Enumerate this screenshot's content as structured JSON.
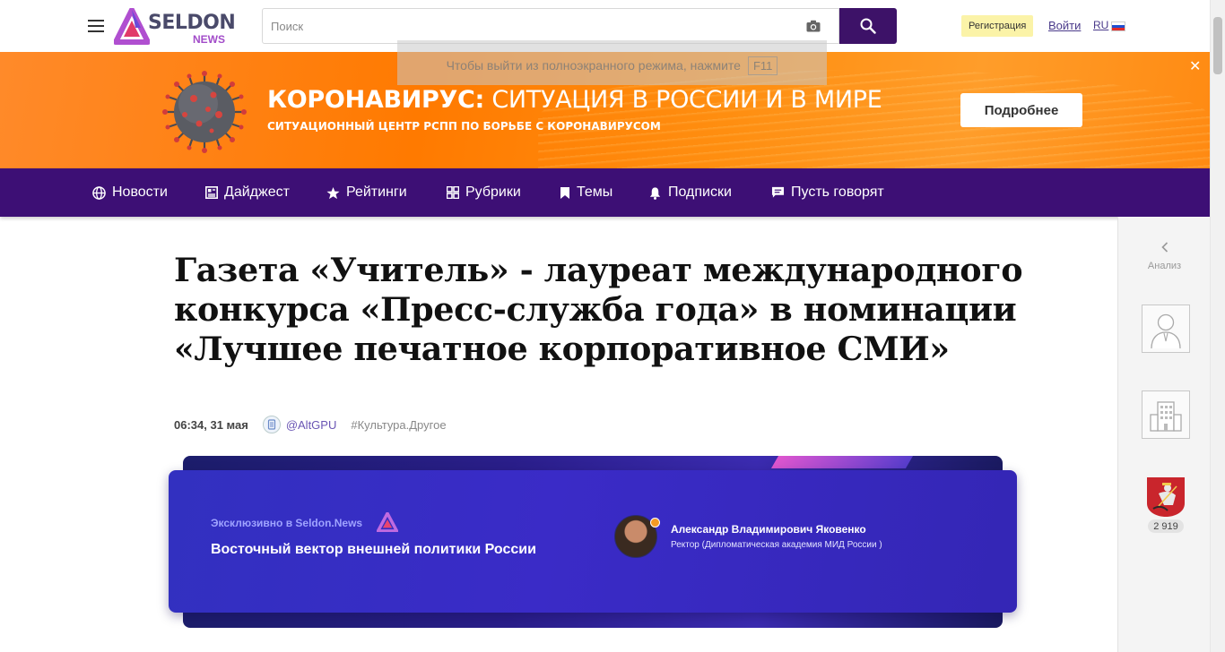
{
  "header": {
    "logo_text": "SELDON",
    "logo_sub": "NEWS",
    "search_placeholder": "Поиск",
    "register_label": "Регистрация",
    "login_label": "Войти",
    "lang_label": "RU"
  },
  "fullscreen_tip": {
    "text": "Чтобы выйти из полноэкранного режима, нажмите",
    "key": "F11"
  },
  "banner": {
    "title_bold": "КОРОНАВИРУС:",
    "title_rest": " СИТУАЦИЯ В РОССИИ И В МИРЕ",
    "subtitle": "СИТУАЦИОННЫЙ ЦЕНТР РСПП ПО БОРЬБЕ С КОРОНАВИРУСОМ",
    "button_label": "Подробнее",
    "close_glyph": "✕",
    "color": "#ff7a00"
  },
  "nav": {
    "color": "#3d0f75",
    "items": [
      {
        "label": "Новости",
        "icon": "globe-icon"
      },
      {
        "label": "Дайджест",
        "icon": "newspaper-icon"
      },
      {
        "label": "Рейтинги",
        "icon": "star-icon"
      },
      {
        "label": "Рубрики",
        "icon": "grid-icon"
      },
      {
        "label": "Темы",
        "icon": "bookmark-icon"
      },
      {
        "label": "Подписки",
        "icon": "bell-icon"
      },
      {
        "label": "Пусть говорят",
        "icon": "message-icon"
      }
    ]
  },
  "sidebar_right": {
    "label": "Анализ",
    "count": "2 919"
  },
  "article": {
    "title": "Газета «Учитель» - лауреат международного конкурса «Пресс-служба года» в номинации «Лучшее печатное корпоративное СМИ»",
    "date": "06:34, 31 мая",
    "source": "@AltGPU",
    "tag": "#Культура.Другое"
  },
  "exclusive": {
    "label": "Эксклюзивно в Seldon.News",
    "title": "Восточный вектор внешней политики России",
    "person_name": "Александр Владимирович Яковенко",
    "person_role": "Ректор (Дипломатическая академия МИД России )"
  }
}
